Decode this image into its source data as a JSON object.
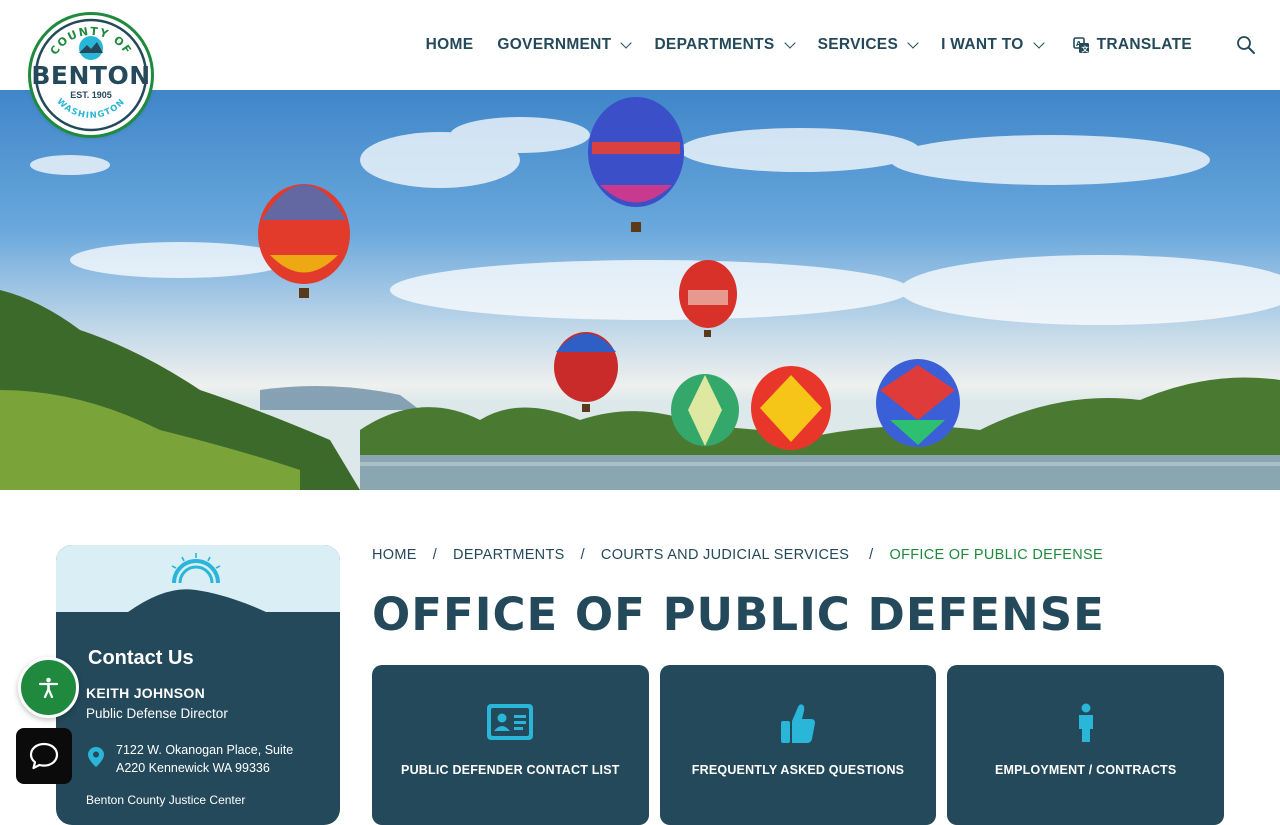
{
  "logo": {
    "county_of": "COUNTY OF",
    "name": "BENTON",
    "est": "EST. 1905",
    "state": "WASHINGTON"
  },
  "nav": {
    "items": [
      {
        "label": "HOME",
        "dropdown": false
      },
      {
        "label": "GOVERNMENT",
        "dropdown": true
      },
      {
        "label": "DEPARTMENTS",
        "dropdown": true
      },
      {
        "label": "SERVICES",
        "dropdown": true
      },
      {
        "label": "I WANT TO",
        "dropdown": true
      }
    ],
    "translate": "TRANSLATE",
    "search_icon": "search-icon"
  },
  "hero": {
    "description": "Hot air balloons over river"
  },
  "sidebar": {
    "title": "Contact Us",
    "name": "KEITH JOHNSON",
    "role": "Public Defense Director",
    "address": "7122 W. Okanogan Place, Suite A220 Kennewick WA 99336",
    "more": "Benton County Justice Center"
  },
  "breadcrumb": {
    "items": [
      "HOME",
      "DEPARTMENTS",
      "COURTS AND JUDICIAL SERVICES"
    ],
    "current": "OFFICE OF PUBLIC DEFENSE"
  },
  "page": {
    "title": "OFFICE OF PUBLIC DEFENSE"
  },
  "cards": [
    {
      "label": "PUBLIC DEFENDER CONTACT LIST",
      "icon": "id-card-icon"
    },
    {
      "label": "FREQUENTLY ASKED QUESTIONS",
      "icon": "thumbs-up-icon"
    },
    {
      "label": "EMPLOYMENT / CONTRACTS",
      "icon": "person-icon"
    }
  ],
  "colors": {
    "primary": "#24495a",
    "accent_green": "#1f8a3e",
    "icon_cyan": "#29b6d8",
    "sidebar_top": "#d9eff5"
  }
}
